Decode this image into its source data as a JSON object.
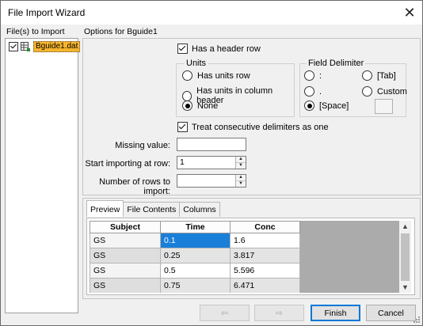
{
  "window": {
    "title": "File Import Wizard"
  },
  "files": {
    "label": "File(s) to Import",
    "items": [
      {
        "name": "Bguide1.dat",
        "checked": true
      }
    ]
  },
  "options": {
    "label": "Options for Bguide1",
    "has_header_row": {
      "label": "Has a header row",
      "checked": true
    },
    "units": {
      "title": "Units",
      "choices": [
        {
          "label": "Has units row",
          "checked": false
        },
        {
          "label": "Has units in column header",
          "checked": false
        },
        {
          "label": "None",
          "checked": true
        }
      ]
    },
    "delimiter": {
      "title": "Field Delimiter",
      "choices": [
        {
          "label": ":",
          "checked": false
        },
        {
          "label": "[Tab]",
          "checked": false
        },
        {
          "label": ".",
          "checked": false
        },
        {
          "label": "Custom",
          "checked": false
        },
        {
          "label": "[Space]",
          "checked": true
        }
      ],
      "custom_value": ""
    },
    "treat_consecutive": {
      "label": "Treat consecutive delimiters as one",
      "checked": true
    },
    "missing_value": {
      "label": "Missing value:",
      "value": ""
    },
    "start_row": {
      "label": "Start importing at row:",
      "value": "1"
    },
    "num_rows": {
      "label": "Number of rows to import:",
      "value": ""
    }
  },
  "preview": {
    "tabs": [
      {
        "label": "Preview",
        "active": true
      },
      {
        "label": "File Contents",
        "active": false
      },
      {
        "label": "Columns",
        "active": false
      }
    ],
    "columns": [
      "Subject",
      "Time",
      "Conc"
    ],
    "rows": [
      [
        "GS",
        "0.1",
        "1.6"
      ],
      [
        "GS",
        "0.25",
        "3.817"
      ],
      [
        "GS",
        "0.5",
        "5.596"
      ],
      [
        "GS",
        "0.75",
        "6.471"
      ]
    ]
  },
  "buttons": {
    "back": "⇦",
    "next": "⇨",
    "finish": "Finish",
    "cancel": "Cancel"
  },
  "colors": {
    "selection": "#1a7fd8",
    "file_highlight": "#f7b52c",
    "default_button_border": "#0078d7"
  }
}
